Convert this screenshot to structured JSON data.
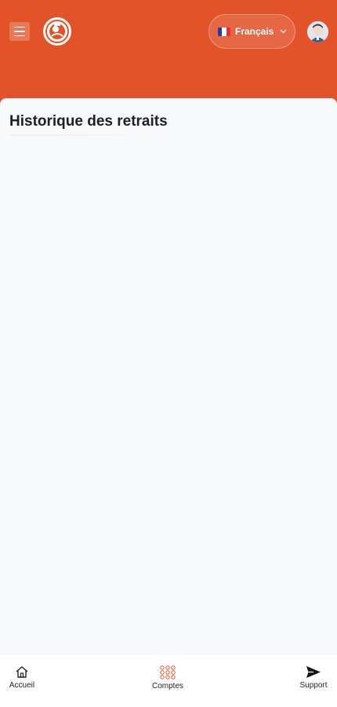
{
  "header": {
    "language": {
      "flag": "french-flag-icon",
      "label": "Français"
    },
    "colors": {
      "brand": "#e2532a"
    }
  },
  "main": {
    "title": "Historique des retraits"
  },
  "bottom_nav": {
    "items": [
      {
        "icon": "home-icon",
        "label": "Accueil"
      },
      {
        "icon": "grid-icon",
        "label": "Comptes"
      },
      {
        "icon": "send-icon",
        "label": "Support"
      }
    ]
  }
}
